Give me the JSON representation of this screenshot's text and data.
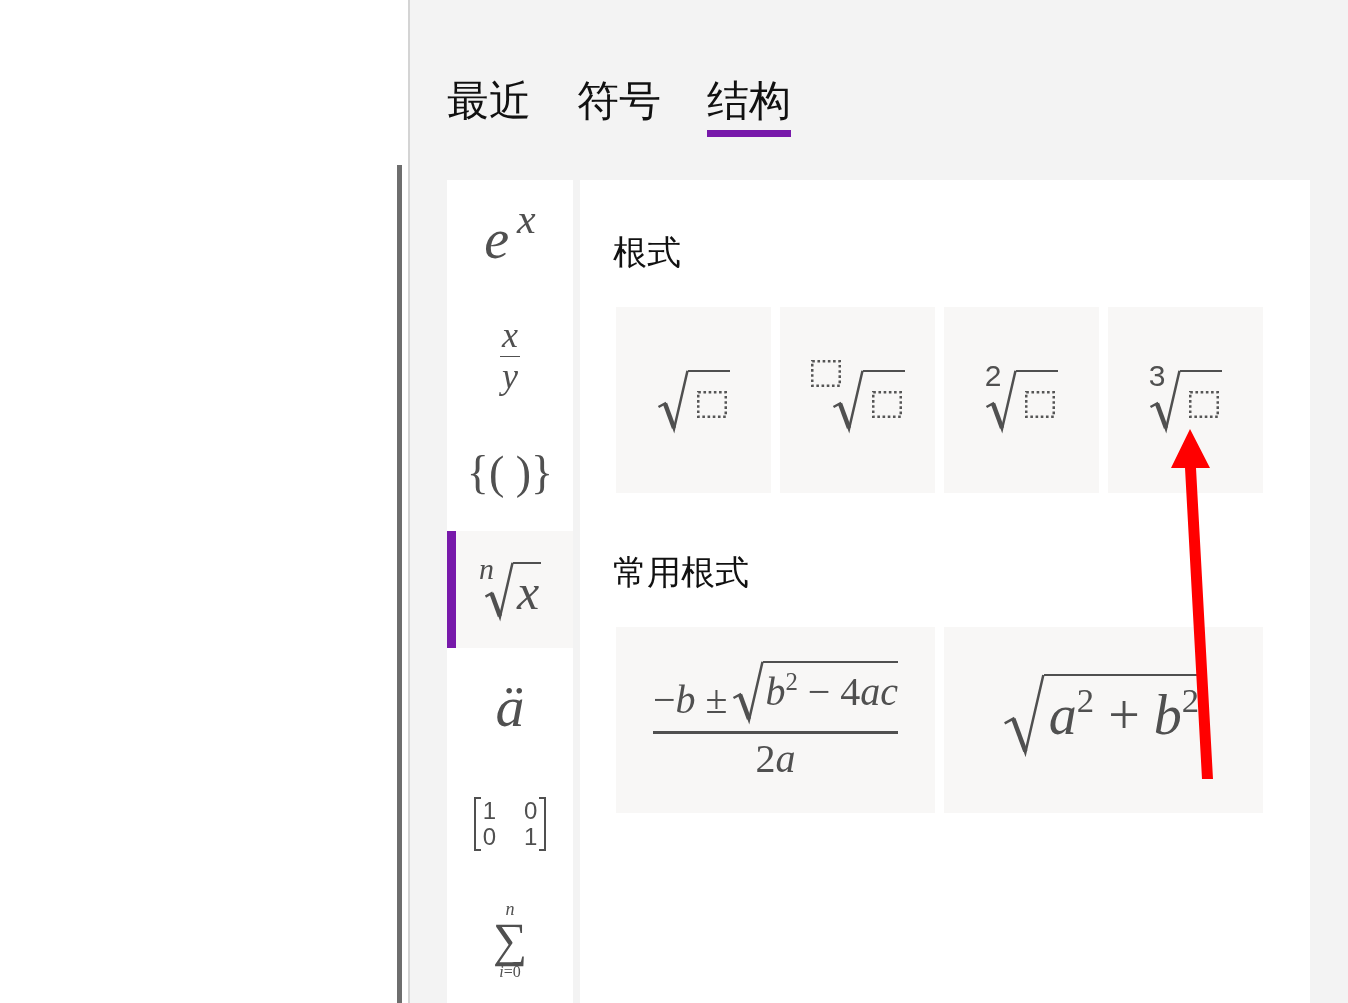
{
  "tabs": [
    {
      "label": "最近",
      "selected": false
    },
    {
      "label": "符号",
      "selected": false
    },
    {
      "label": "结构",
      "selected": true
    }
  ],
  "categories": [
    {
      "kind": "power",
      "base": "e",
      "exponent": "x",
      "selected": false
    },
    {
      "kind": "fraction",
      "numerator": "x",
      "denominator": "y",
      "selected": false
    },
    {
      "kind": "brackets",
      "text": "{( )}",
      "selected": false
    },
    {
      "kind": "radical",
      "index": "n",
      "radicand": "x",
      "selected": true
    },
    {
      "kind": "accent",
      "text": "ä",
      "selected": false
    },
    {
      "kind": "matrix",
      "rows": [
        [
          "1",
          "0"
        ],
        [
          "0",
          "1"
        ]
      ],
      "selected": false
    },
    {
      "kind": "large-operator",
      "operator": "∑",
      "upper": "n",
      "lower": "i=0",
      "selected": false
    }
  ],
  "sections": [
    {
      "title": "根式",
      "items": [
        {
          "kind": "square-root"
        },
        {
          "kind": "root-with-index-box"
        },
        {
          "kind": "indexed-root",
          "index": "2"
        },
        {
          "kind": "indexed-root",
          "index": "3"
        }
      ]
    },
    {
      "title": "常用根式",
      "items": [
        {
          "kind": "root-fraction",
          "prefix": "−b ±",
          "radicand": "b$^{2}$ − 4ac",
          "denominator": "2a"
        },
        {
          "kind": "root",
          "radicand": "a$^{2}$ + b$^{2}$"
        }
      ]
    }
  ],
  "annotation": {
    "kind": "arrow"
  }
}
